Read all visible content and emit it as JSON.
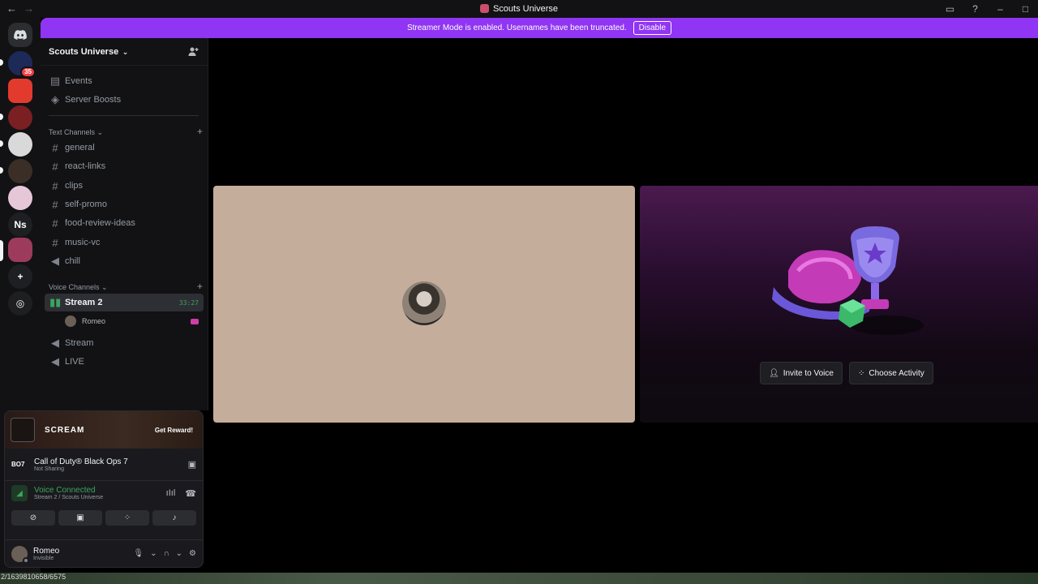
{
  "titlebar": {
    "title": "Scouts Universe",
    "back": "←",
    "forward": "→"
  },
  "banner": {
    "text": "Streamer Mode is enabled. Usernames have been truncated.",
    "button": "Disable"
  },
  "rail": {
    "unread_badge": "35",
    "ns_label": "Ns"
  },
  "guild": {
    "name": "Scouts Universe"
  },
  "nav": {
    "events": "Events",
    "boosts": "Server Boosts"
  },
  "text_section": "Text Channels",
  "text_channels": [
    "general",
    "react-links",
    "clips",
    "self-promo",
    "food-review-ideas",
    "music-vc",
    "chill"
  ],
  "voice_section": "Voice Channels",
  "voice_channels": {
    "active": {
      "name": "Stream 2",
      "timer": "33:27",
      "member": "Romeo"
    },
    "others": [
      "Stream",
      "LIVE"
    ]
  },
  "promo": {
    "brand": "SCREAM",
    "cta": "Get Reward!"
  },
  "activity": {
    "game_abbr": "BO7",
    "title": "Call of Duty® Black Ops 7",
    "status": "Not Sharing"
  },
  "voice": {
    "status": "Voice Connected",
    "location": "Stream 2 / Scouts Universe"
  },
  "user": {
    "name": "Romeo",
    "status": "Invisible"
  },
  "stage": {
    "invite_label": "Invite to Voice",
    "activity_label": "Choose Activity"
  },
  "footer": {
    "id_text": "2/1639810658/6575"
  },
  "colors": {
    "accent": "#8f35f3",
    "voice_green": "#3ba55d",
    "danger": "#f23f43"
  }
}
